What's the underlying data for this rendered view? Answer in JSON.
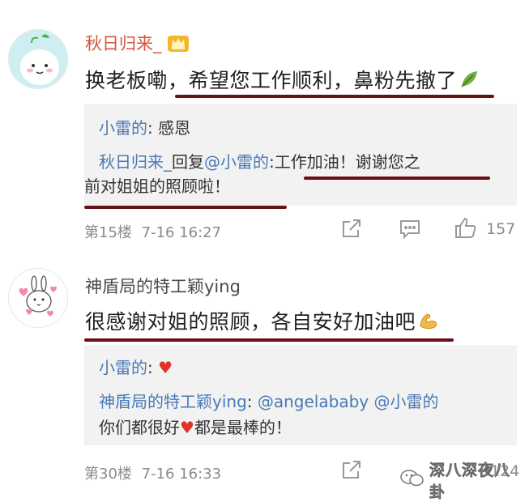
{
  "comments": [
    {
      "username": "秋日归来_",
      "badge_icon": "crown-badge-icon",
      "text": "换老板嘞，希望您工作顺利，鼻粉先撤了",
      "emoji": "leaf-icon",
      "replies": [
        {
          "name": "小雷的",
          "sep": ": ",
          "text": "感恩"
        },
        {
          "name": "秋日归来_",
          "mid": "回复",
          "mention": "@小雷的",
          "sep": ":",
          "text": "工作加油！谢谢您之",
          "text2": "前对姐姐的照顾啦！"
        }
      ],
      "floor": "第15楼",
      "time": "7-16 16:27",
      "like_count": "157"
    },
    {
      "username": "神盾局的特工颖ying",
      "text": "很感谢对姐的照顾，各自安好加油吧",
      "emoji": "flexed-arm-icon",
      "replies": [
        {
          "name": "小雷的",
          "sep": ": ",
          "emoji": "red-heart-icon"
        },
        {
          "name": "神盾局的特工颖ying",
          "sep": ": ",
          "mention": "@angelababy @小雷的",
          "text2a": "你们都很好",
          "text2b": "都是最棒的！"
        }
      ],
      "floor": "第30楼",
      "time": "7-16 16:33",
      "like_count": "124"
    }
  ],
  "watermark": "深八深夜八卦",
  "colors": {
    "link": "#4a79b5",
    "underline": "#6b0f16",
    "heart": "#e0322c",
    "reply_bg": "#f2f2f2"
  }
}
